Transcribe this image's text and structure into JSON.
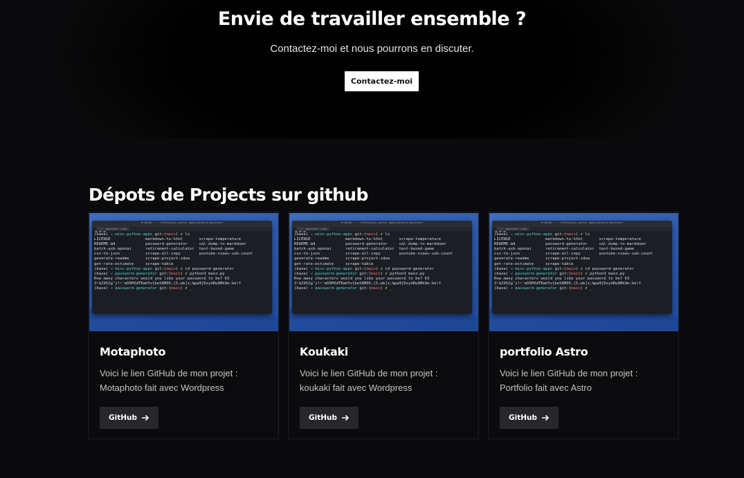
{
  "contact": {
    "title": "Envie de travailler ensemble ?",
    "subtitle": "Contactez-moi et nous pourrons en discuter.",
    "button_label": "Contactez-moi"
  },
  "projects": {
    "section_title": "Dépots de Projects sur github",
    "button_icon": "arrow-right-icon",
    "terminal": {
      "window_path": "arnaud@...: ~/Sites/misc-python-apps/password-generator",
      "tab_label": "~/...generator (zsh)",
      "lines": [
        "(base) → misc-python-apps git:(main) ✗ ls",
        "LICENSE               markdown-to-html       scrape-temperature",
        "README.md             password-generator     sql-dump-to-markdown",
        "batch-ask-openai      retirement-calculator  text-based-game",
        "csv-to-json           scrape-all-copy        youtube-views-sub-count",
        "generate-readme       scrape-project-idea",
        "get-rate-estimate     scrape-table",
        "(base) → misc-python-apps git:(main) ✗ cd password-generator",
        "(base) → password-generator git:(main) ✗ python3 main.py",
        "How many characters would you like your password to be? 63",
        "Z~$2952g'}!~'eD9PKdTRaUYv{keS0B0V,(5,wb]z;&pa9]DzySRw9Mk9e:Ge!f",
        "(base) → password-generator git:(main) ✗ _"
      ]
    },
    "cards": [
      {
        "title": "Motaphoto",
        "desc_line1": "Voici le lien GitHub de mon projet :",
        "desc_line2": "Motaphoto fait avec Wordpress",
        "button_label": "GitHub"
      },
      {
        "title": "Koukaki",
        "desc_line1": "Voici le lien GitHub de mon projet :",
        "desc_line2": "koukaki fait avec Wordpress",
        "button_label": "GitHub"
      },
      {
        "title": "portfolio Astro",
        "desc_line1": "Voici le lien GitHub de mon projet :",
        "desc_line2": "Portfolio fait avec Astro",
        "button_label": "GitHub"
      }
    ]
  },
  "colors": {
    "page_background": "#0a0a0c",
    "card_border": "#1f1f22",
    "button_dark": "#27272b",
    "button_light": "#ffffff",
    "thumbnail_blue": "#2f5caf"
  }
}
